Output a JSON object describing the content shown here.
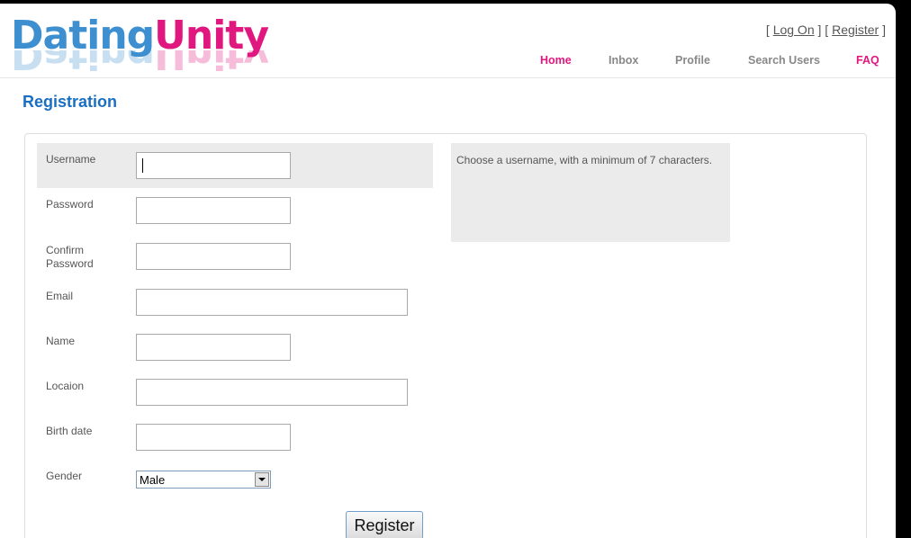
{
  "logo": {
    "part1": "Dating",
    "part2": "Unity"
  },
  "auth": {
    "open": "[ ",
    "login": "Log On",
    "sep": " ] [ ",
    "register": "Register",
    "close": " ]"
  },
  "menu": {
    "home": "Home",
    "inbox": "Inbox",
    "profile": "Profile",
    "search": "Search Users",
    "faq": "FAQ"
  },
  "page_title": "Registration",
  "form": {
    "username_label": "Username",
    "password_label": "Password",
    "confirm_label": "Confirm Password",
    "email_label": "Email",
    "name_label": "Name",
    "location_label": "Locaion",
    "birthdate_label": "Birth date",
    "gender_label": "Gender",
    "gender_value": "Male",
    "submit_label": "Register"
  },
  "hint": "Choose a username, with a minimum of 7 characters.",
  "colors": {
    "brand_blue": "#3d8fd0",
    "brand_pink": "#e0177e",
    "title_blue": "#1a6fc2"
  }
}
